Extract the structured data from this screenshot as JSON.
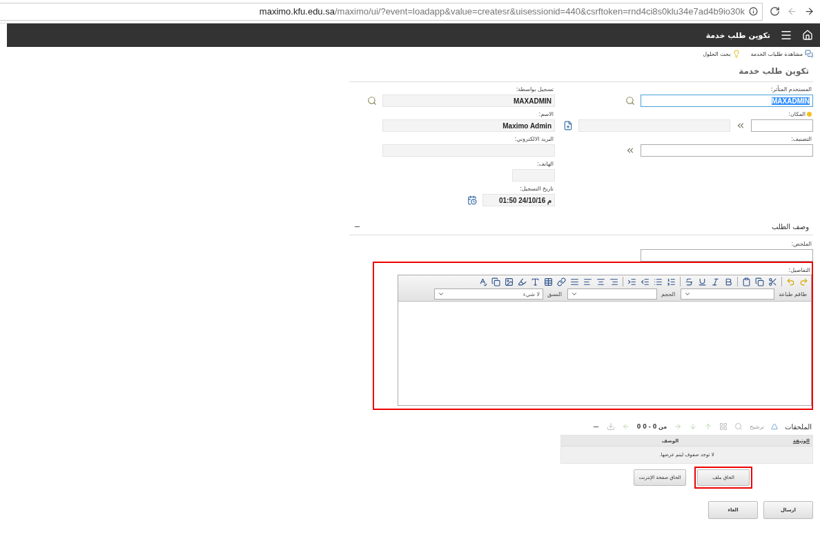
{
  "browser": {
    "url_host": "maximo.kfu.edu.sa",
    "url_path": "/maximo/ui/?event=loadapp&value=createsr&uisessionid=440&csrftoken=rnd4ci8s0klu34e7ad4b9io30k"
  },
  "header": {
    "title": "تكوين طلب خدمة"
  },
  "links": [
    {
      "label": "مشاهدة طلبات الخدمة",
      "kind": "view"
    },
    {
      "label": "بحث الحلول",
      "kind": "solutions"
    }
  ],
  "page_title": "تكوين طلب خدمة",
  "form": {
    "right": [
      {
        "label": "المستخدم المتأثر:",
        "value": "MAXADMIN",
        "kind": "lookup",
        "focused": true,
        "required": false
      },
      {
        "label": "المكان:",
        "kind": "location",
        "focused": false,
        "required": true
      },
      {
        "label": "التصنيف:",
        "kind": "classify",
        "focused": false,
        "required": false
      }
    ],
    "left": [
      {
        "label": "تسجيل بواسطة:",
        "value": "MAXADMIN",
        "kind": "lookup"
      },
      {
        "label": "الاسم:",
        "value": "Maximo Admin",
        "kind": "readonly"
      },
      {
        "label": "البريد الالكتروني:",
        "kind": "readonly"
      },
      {
        "label": "الهاتف:",
        "kind": "short"
      },
      {
        "label": "تاريخ التسجيل:",
        "value": "01:50 24/10/16 م",
        "kind": "date"
      }
    ]
  },
  "description": {
    "title": "وصف الطلب",
    "summary_label": "الملخص:",
    "details_label": "التفاصيل:",
    "details_highlighted": true,
    "selects": [
      {
        "label": "طاقم طباعة"
      },
      {
        "label": "الحجم"
      },
      {
        "label": "النسق",
        "value": "لا شيء"
      }
    ]
  },
  "attachments": {
    "title": "الملحقات",
    "filter": "ترشيح",
    "paging": "0 من 0 - 0",
    "columns": [
      "الوثيقة",
      "الوصف"
    ],
    "empty": "لا توجد صفوف ليتم عرضها.",
    "buttons": [
      {
        "label": "الحاق ملف",
        "highlighted": true
      },
      {
        "label": "الحاق صفحة الإنترنت",
        "highlighted": false
      }
    ]
  },
  "actions": [
    {
      "label": "ارسال"
    },
    {
      "label": "الغاء"
    }
  ]
}
